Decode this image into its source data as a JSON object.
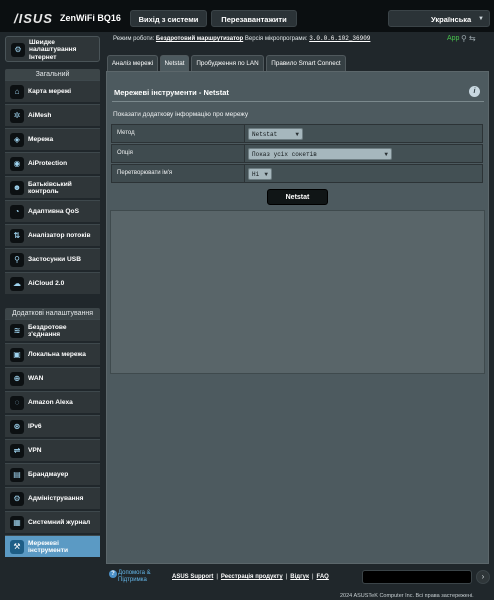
{
  "header": {
    "logo": "/ISUS",
    "model": "ZenWiFi BQ16",
    "logout_label": "Вихід з системи",
    "reboot_label": "Перезавантажити",
    "language": "Українська"
  },
  "status": {
    "mode_label": "Режим роботи:",
    "mode_value": "Бездротовий маршрутизатор",
    "fw_label": "Версія мікропрограми:",
    "fw_value": "3.0.0.6.102_36909",
    "app_label": "App"
  },
  "sidebar": {
    "quick_setup": "Швидке налаштування Інтернет",
    "general_header": "Загальний",
    "general_items": [
      {
        "label": "Карта мережі",
        "icon": "network-map-icon",
        "glyph": "⌂"
      },
      {
        "label": "AiMesh",
        "icon": "aimesh-icon",
        "glyph": "✲"
      },
      {
        "label": "Мережа",
        "icon": "network-icon",
        "glyph": "◈"
      },
      {
        "label": "AiProtection",
        "icon": "aiprotection-icon",
        "glyph": "◉"
      },
      {
        "label": "Батьківський контроль",
        "icon": "parental-control-icon",
        "glyph": "☻"
      },
      {
        "label": "Адаптивна QoS",
        "icon": "adaptive-qos-icon",
        "glyph": "◔"
      },
      {
        "label": "Аналізатор потоків",
        "icon": "traffic-analyzer-icon",
        "glyph": "⇅"
      },
      {
        "label": "Застосунки USB",
        "icon": "usb-apps-icon",
        "glyph": "⚲"
      },
      {
        "label": "AiCloud 2.0",
        "icon": "aicloud-icon",
        "glyph": "☁"
      }
    ],
    "advanced_header": "Додаткові налаштування",
    "advanced_items": [
      {
        "label": "Бездротове з'єднання",
        "icon": "wireless-icon",
        "glyph": "≋"
      },
      {
        "label": "Локальна мережа",
        "icon": "lan-icon",
        "glyph": "▣"
      },
      {
        "label": "WAN",
        "icon": "wan-icon",
        "glyph": "⊕"
      },
      {
        "label": "Amazon Alexa",
        "icon": "alexa-icon",
        "glyph": "◌"
      },
      {
        "label": "IPv6",
        "icon": "ipv6-icon",
        "glyph": "⊛"
      },
      {
        "label": "VPN",
        "icon": "vpn-icon",
        "glyph": "⇌"
      },
      {
        "label": "Брандмауер",
        "icon": "firewall-icon",
        "glyph": "▤"
      },
      {
        "label": "Адміністрування",
        "icon": "administration-icon",
        "glyph": "⚙"
      },
      {
        "label": "Системний журнал",
        "icon": "system-log-icon",
        "glyph": "▦"
      },
      {
        "label": "Мережеві інструменти",
        "icon": "network-tools-icon",
        "glyph": "⚒",
        "active": true
      }
    ]
  },
  "tabs": [
    {
      "label": "Аналіз мережі"
    },
    {
      "label": "Netstat",
      "active": true
    },
    {
      "label": "Пробудження по LAN"
    },
    {
      "label": "Правило Smart Connect"
    }
  ],
  "main": {
    "title": "Мережеві інструменти - Netstat",
    "description": "Показати додаткову інформацію про мережу",
    "rows": [
      {
        "label": "Метод",
        "value": "Netstat"
      },
      {
        "label": "Опція",
        "value": "Показ усіх сокетів"
      },
      {
        "label": "Перетворювати ім'я",
        "value": "Ні"
      }
    ],
    "action_label": "Netstat"
  },
  "footer": {
    "help_label": "Допомога & Підтримка",
    "links": [
      "ASUS Support",
      "Реєстрація продукту",
      "Відгук",
      "FAQ"
    ],
    "copyright": "2024 ASUSTeK Computer Inc. Всі права застережені."
  }
}
